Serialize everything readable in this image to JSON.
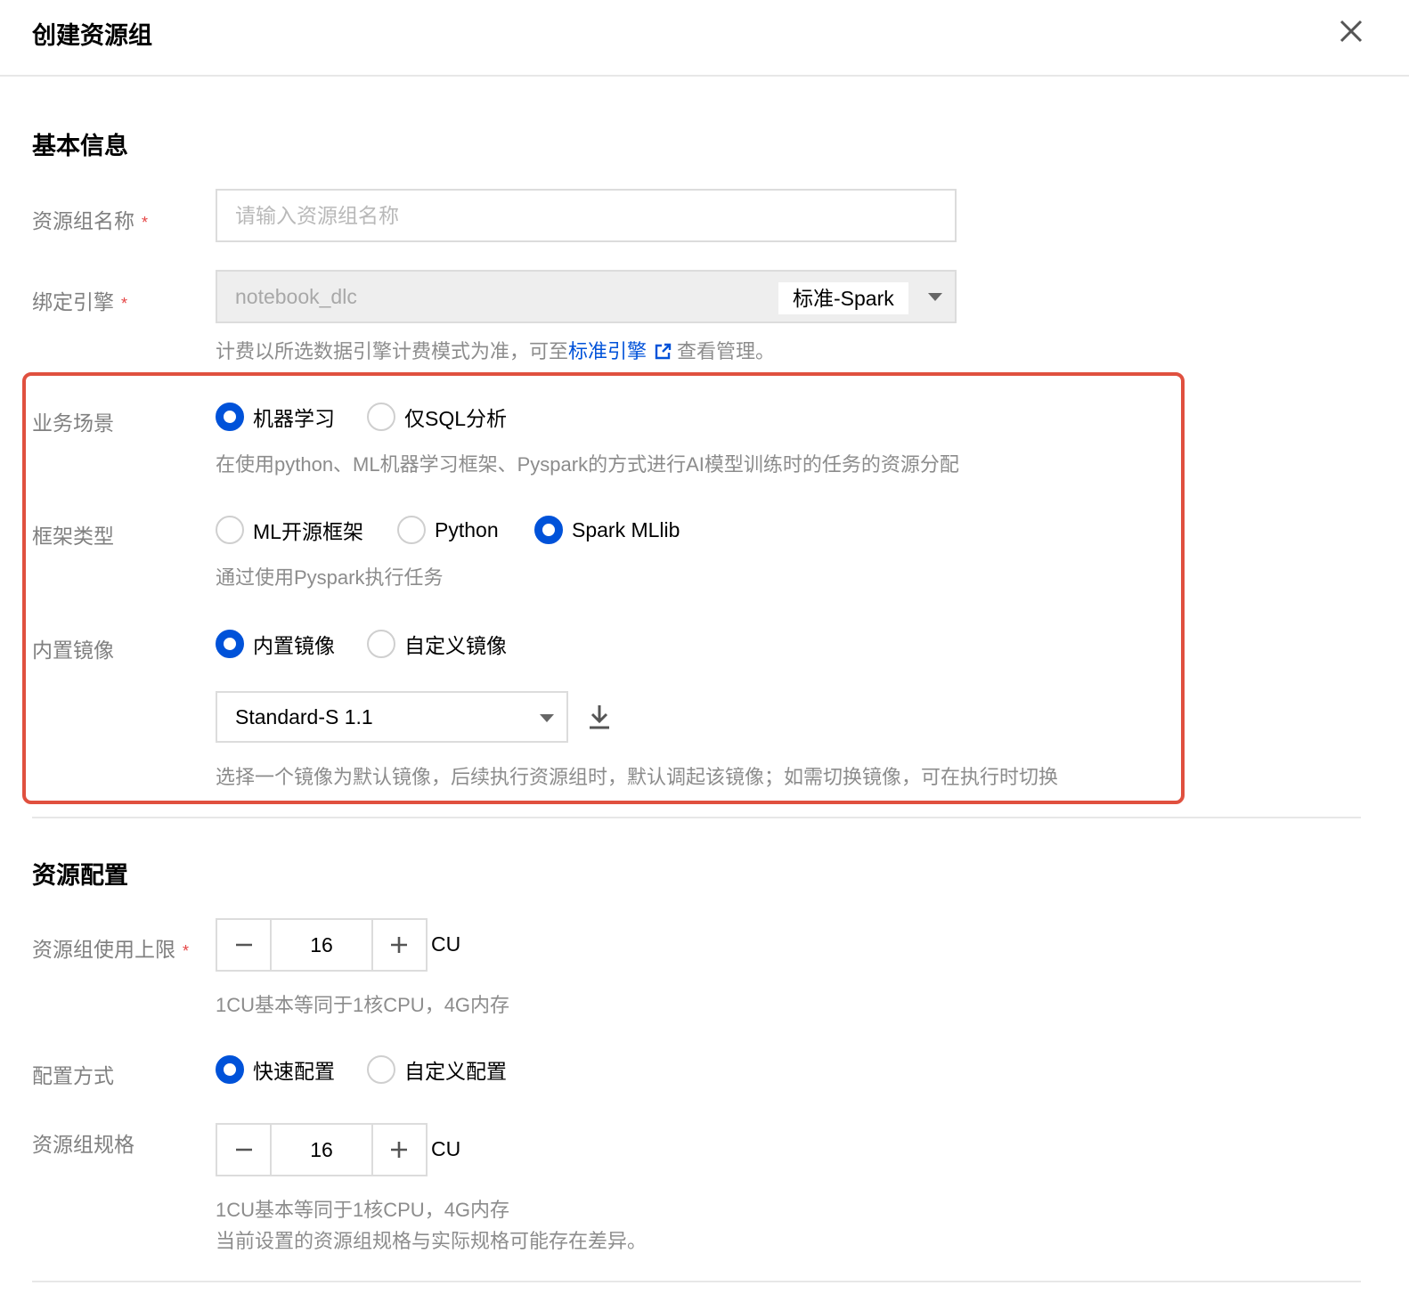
{
  "dialog": {
    "title": "创建资源组"
  },
  "basic": {
    "section_title": "基本信息",
    "name": {
      "label": "资源组名称",
      "required": "*",
      "placeholder": "请输入资源组名称",
      "value": ""
    },
    "engine": {
      "label": "绑定引擎",
      "required": "*",
      "value": "notebook_dlc",
      "tag": "标准-Spark",
      "helper_before": "计费以所选数据引擎计费模式为准，可至",
      "helper_link": "标准引擎",
      "helper_after": "查看管理。"
    },
    "scenario": {
      "label": "业务场景",
      "options": [
        "机器学习",
        "仅SQL分析"
      ],
      "selected": "机器学习",
      "helper": "在使用python、ML机器学习框架、Pyspark的方式进行AI模型训练时的任务的资源分配"
    },
    "framework": {
      "label": "框架类型",
      "options": [
        "ML开源框架",
        "Python",
        "Spark MLlib"
      ],
      "selected": "Spark MLlib",
      "helper": "通过使用Pyspark执行任务"
    },
    "image": {
      "label": "内置镜像",
      "options": [
        "内置镜像",
        "自定义镜像"
      ],
      "selected": "内置镜像",
      "select_value": "Standard-S 1.1",
      "helper": "选择一个镜像为默认镜像，后续执行资源组时，默认调起该镜像；如需切换镜像，可在执行时切换"
    }
  },
  "resource": {
    "section_title": "资源配置",
    "limit": {
      "label": "资源组使用上限",
      "required": "*",
      "value": "16",
      "unit": "CU",
      "helper": "1CU基本等同于1核CPU，4G内存"
    },
    "config_mode": {
      "label": "配置方式",
      "options": [
        "快速配置",
        "自定义配置"
      ],
      "selected": "快速配置"
    },
    "spec": {
      "label": "资源组规格",
      "value": "16",
      "unit": "CU",
      "helper_line1": "1CU基本等同于1核CPU，4G内存",
      "helper_line2": "当前设置的资源组规格与实际规格可能存在差异。"
    }
  },
  "colors": {
    "primary": "#0052d9",
    "highlight_border": "#e0503f",
    "required": "#e54545"
  },
  "icons": [
    "close-icon",
    "external-link-icon",
    "chevron-down-icon",
    "download-icon",
    "minus-icon",
    "plus-icon"
  ]
}
